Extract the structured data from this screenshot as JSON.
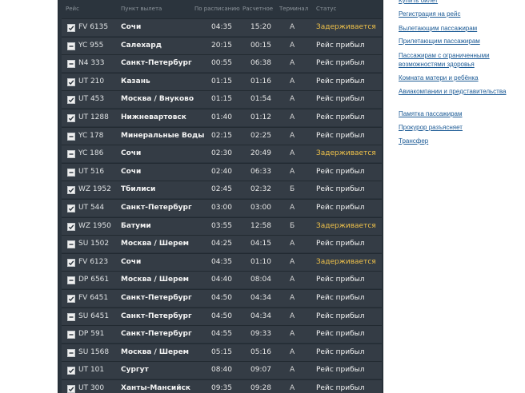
{
  "table": {
    "headers": {
      "flight": "Рейс",
      "origin": "Пункт вылета",
      "scheduled": "По расписанию",
      "estimated": "Расчетное",
      "terminal": "Терминал",
      "status": "Статус"
    },
    "rows": [
      {
        "icon": "checked-icon",
        "flight": "FV 6135",
        "origin": "Сочи",
        "scheduled": "04:35",
        "estimated": "15:20",
        "terminal": "А",
        "status": "Задерживается",
        "state": "delayed"
      },
      {
        "icon": "dash-icon",
        "flight": "YC 955",
        "origin": "Салехард",
        "scheduled": "20:15",
        "estimated": "00:15",
        "terminal": "А",
        "status": "Рейс прибыл",
        "state": "arrived"
      },
      {
        "icon": "dash-icon",
        "flight": "N4 333",
        "origin": "Санкт-Петербург",
        "scheduled": "00:55",
        "estimated": "06:38",
        "terminal": "А",
        "status": "Рейс прибыл",
        "state": "arrived"
      },
      {
        "icon": "checked-icon",
        "flight": "UT 210",
        "origin": "Казань",
        "scheduled": "01:15",
        "estimated": "01:16",
        "terminal": "А",
        "status": "Рейс прибыл",
        "state": "arrived"
      },
      {
        "icon": "checked-icon",
        "flight": "UT 453",
        "origin": "Москва / Внуково",
        "scheduled": "01:15",
        "estimated": "01:54",
        "terminal": "А",
        "status": "Рейс прибыл",
        "state": "arrived"
      },
      {
        "icon": "checked-icon",
        "flight": "UT 1288",
        "origin": "Нижневартовск",
        "scheduled": "01:40",
        "estimated": "01:12",
        "terminal": "А",
        "status": "Рейс прибыл",
        "state": "arrived"
      },
      {
        "icon": "dash-icon",
        "flight": "YC 178",
        "origin": "Минеральные Воды",
        "scheduled": "02:15",
        "estimated": "02:25",
        "terminal": "А",
        "status": "Рейс прибыл",
        "state": "arrived"
      },
      {
        "icon": "dash-icon",
        "flight": "YC 186",
        "origin": "Сочи",
        "scheduled": "02:30",
        "estimated": "20:49",
        "terminal": "А",
        "status": "Задерживается",
        "state": "delayed"
      },
      {
        "icon": "dash-icon",
        "flight": "UT 516",
        "origin": "Сочи",
        "scheduled": "02:40",
        "estimated": "06:33",
        "terminal": "А",
        "status": "Рейс прибыл",
        "state": "arrived"
      },
      {
        "icon": "checked-icon",
        "flight": "WZ 1952",
        "origin": "Тбилиси",
        "scheduled": "02:45",
        "estimated": "02:32",
        "terminal": "Б",
        "status": "Рейс прибыл",
        "state": "arrived"
      },
      {
        "icon": "checked-icon",
        "flight": "UT 544",
        "origin": "Санкт-Петербург",
        "scheduled": "03:00",
        "estimated": "03:00",
        "terminal": "А",
        "status": "Рейс прибыл",
        "state": "arrived"
      },
      {
        "icon": "checked-icon",
        "flight": "WZ 1950",
        "origin": "Батуми",
        "scheduled": "03:55",
        "estimated": "12:58",
        "terminal": "Б",
        "status": "Задерживается",
        "state": "delayed"
      },
      {
        "icon": "dash-icon",
        "flight": "SU 1502",
        "origin": "Москва / Шерем",
        "scheduled": "04:25",
        "estimated": "04:15",
        "terminal": "А",
        "status": "Рейс прибыл",
        "state": "arrived"
      },
      {
        "icon": "checked-icon",
        "flight": "FV 6123",
        "origin": "Сочи",
        "scheduled": "04:35",
        "estimated": "01:10",
        "terminal": "А",
        "status": "Задерживается",
        "state": "delayed"
      },
      {
        "icon": "dash-icon",
        "flight": "DP 6561",
        "origin": "Москва / Шерем",
        "scheduled": "04:40",
        "estimated": "08:04",
        "terminal": "А",
        "status": "Рейс прибыл",
        "state": "arrived"
      },
      {
        "icon": "checked-icon",
        "flight": "FV 6451",
        "origin": "Санкт-Петербург",
        "scheduled": "04:50",
        "estimated": "04:34",
        "terminal": "А",
        "status": "Рейс прибыл",
        "state": "arrived"
      },
      {
        "icon": "dash-icon",
        "flight": "SU 6451",
        "origin": "Санкт-Петербург",
        "scheduled": "04:50",
        "estimated": "04:34",
        "terminal": "А",
        "status": "Рейс прибыл",
        "state": "arrived"
      },
      {
        "icon": "dash-icon",
        "flight": "DP 591",
        "origin": "Санкт-Петербург",
        "scheduled": "04:55",
        "estimated": "09:33",
        "terminal": "А",
        "status": "Рейс прибыл",
        "state": "arrived"
      },
      {
        "icon": "dash-icon",
        "flight": "SU 1568",
        "origin": "Москва / Шерем",
        "scheduled": "05:15",
        "estimated": "05:16",
        "terminal": "А",
        "status": "Рейс прибыл",
        "state": "arrived"
      },
      {
        "icon": "checked-icon",
        "flight": "UT 101",
        "origin": "Сургут",
        "scheduled": "08:40",
        "estimated": "09:07",
        "terminal": "А",
        "status": "Рейс прибыл",
        "state": "arrived"
      },
      {
        "icon": "checked-icon",
        "flight": "UT 300",
        "origin": "Ханты-Мансийск",
        "scheduled": "09:35",
        "estimated": "09:28",
        "terminal": "А",
        "status": "Рейс прибыл",
        "state": "arrived"
      }
    ]
  },
  "sidebar": {
    "links": [
      {
        "label": "Купить билет"
      },
      {
        "label": "Регистрация на рейс"
      },
      {
        "label": "Вылетающим пассажирам"
      },
      {
        "label": "Прилетающим пассажирам"
      },
      {
        "label": "Пассажирам с ограниченными возможностями здоровья"
      },
      {
        "label": "Комната матери и ребёнка"
      },
      {
        "label": "Авиакомпании и представительства"
      },
      {
        "label": "Памятка пассажирам"
      },
      {
        "label": "Прокурор разъясняет"
      },
      {
        "label": "Трансфер"
      }
    ]
  },
  "colors": {
    "delayed": "#f0c24a",
    "arrived": "#f2f2f2",
    "board": "#2b343d",
    "link": "#1b5a95"
  }
}
